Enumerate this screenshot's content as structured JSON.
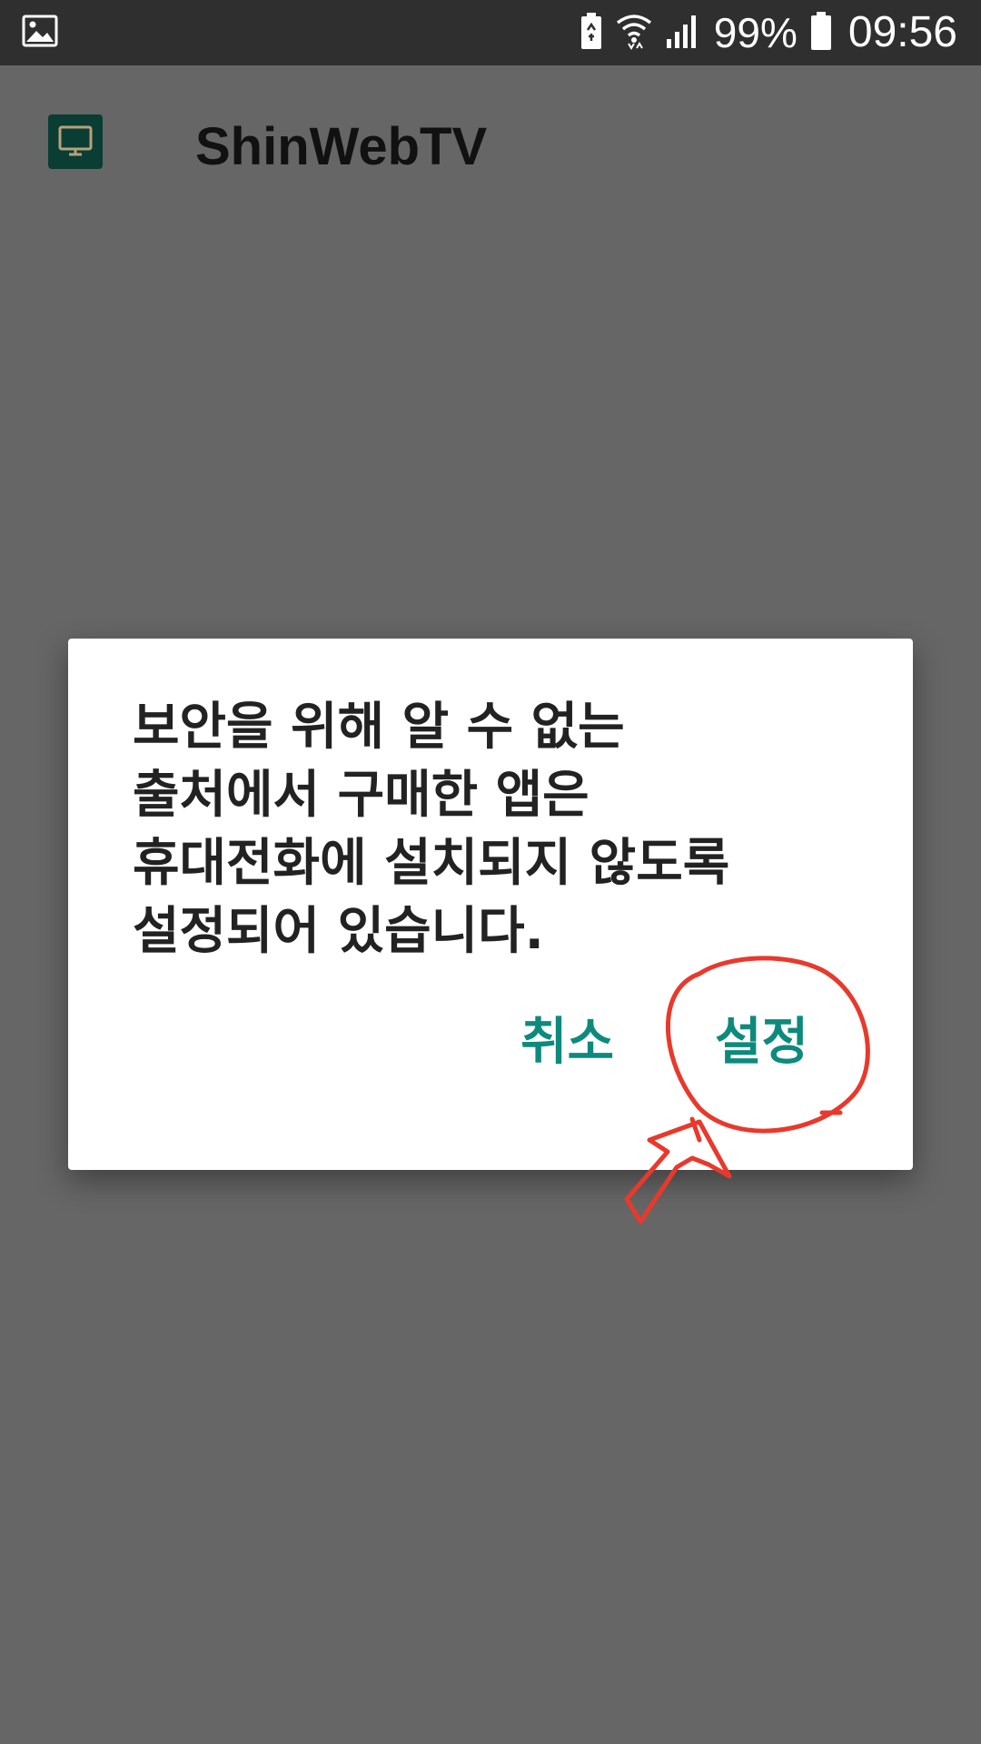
{
  "status_bar": {
    "left_icon": "gallery-image-icon",
    "icons": [
      "battery-saver-icon",
      "wifi-icon",
      "signal-icon",
      "battery-icon"
    ],
    "battery_percent": "99%",
    "time": "09:56"
  },
  "app_bar": {
    "icon": "tv-monitor-icon",
    "title": "ShinWebTV"
  },
  "dialog": {
    "message": "보안을 위해 알 수 없는\n출처에서 구매한 앱은\n휴대전화에 설치되지 않도록\n설정되어 있습니다.",
    "cancel_label": "취소",
    "settings_label": "설정"
  },
  "annotation": {
    "type": "hand-drawn circle and arrow",
    "color": "#e8392c",
    "target": "설정"
  },
  "colors": {
    "scrim": "#666666",
    "status_bar": "#2f2f2f",
    "button_text": "#0e8a7d",
    "annotation": "#e8392c"
  }
}
